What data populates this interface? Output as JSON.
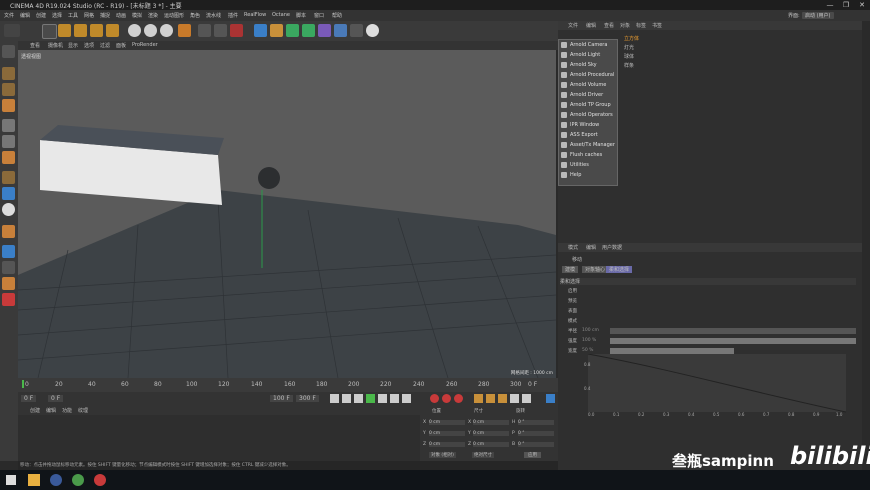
{
  "window": {
    "title": "CINEMA 4D R19.024 Studio (RC - R19) - [未标题 3 *] - 主要",
    "controls": [
      "—",
      "❐",
      "✕"
    ]
  },
  "menubar": {
    "items": [
      "文件",
      "编辑",
      "创建",
      "选择",
      "工具",
      "网格",
      "捕捉",
      "动画",
      "模拟",
      "渲染",
      "运动图形",
      "角色",
      "流水线",
      "插件",
      "RealFlow",
      "Octane",
      "脚本",
      "窗口",
      "帮助"
    ],
    "layout_label": "界面:",
    "layout_value": "启动 (用户)"
  },
  "viewport": {
    "menu": [
      "查看",
      "摄像机",
      "显示",
      "选项",
      "过滤",
      "面板",
      "ProRender"
    ],
    "camera_label": "透视视图",
    "grid_label": "网格间距 : 1000 cm"
  },
  "timeline": {
    "ticks": [
      "0",
      "20",
      "40",
      "60",
      "80",
      "100",
      "120",
      "140",
      "160",
      "180",
      "200",
      "220",
      "240",
      "260",
      "280",
      "300"
    ],
    "frame_end": "0 F"
  },
  "transport": {
    "start": "0 F",
    "current": "0 F",
    "end": "100 F",
    "max": "300 F"
  },
  "material": {
    "menu": [
      "创建",
      "编辑",
      "功能",
      "纹理"
    ]
  },
  "coords": {
    "headers": [
      "位置",
      "尺寸",
      "旋转"
    ],
    "rows": [
      {
        "axis": "X",
        "pos": "0 cm",
        "size": "0 cm",
        "rotl": "H",
        "rot": "0 °"
      },
      {
        "axis": "Y",
        "pos": "0 cm",
        "size": "0 cm",
        "rotl": "P",
        "rot": "0 °"
      },
      {
        "axis": "Z",
        "pos": "0 cm",
        "size": "0 cm",
        "rotl": "B",
        "rot": "0 °"
      }
    ],
    "mode": "对象 (相对)",
    "size_mode": "绝对尺寸",
    "apply": "应用"
  },
  "status": {
    "text": "移动：点击并拖动鼠标移动元素。按住 SHIFT 键量化移动；节点编辑模式时按住 SHIFT 键增加选择对象；按住 CTRL 键减少选择对象。"
  },
  "object_manager": {
    "menu": [
      "文件",
      "编辑",
      "查看",
      "对象",
      "标签",
      "书签"
    ],
    "objects": [
      {
        "name": "立方体"
      },
      {
        "name": "灯光"
      },
      {
        "name": "球体"
      },
      {
        "name": "样条"
      }
    ]
  },
  "dropdown_menu": {
    "items": [
      "Arnold Camera",
      "Arnold Light",
      "Arnold Sky",
      "Arnold Procedural",
      "Arnold Volume",
      "Arnold Driver",
      "Arnold TP Group",
      "Arnold Operators",
      "IPR Window",
      "ASS Export",
      "Asset/Tx Manager",
      "Flush caches",
      "Utilities",
      "Help"
    ]
  },
  "attributes": {
    "menu": [
      "模式",
      "编辑",
      "用户数据"
    ],
    "title": "移动",
    "tabs": [
      "建模",
      "对象轴心",
      "柔和选择"
    ],
    "section": "柔和选择",
    "fields": [
      "启用",
      "预览",
      "表面",
      "模式",
      "半径",
      "强度",
      "宽度"
    ],
    "field_values": [
      "",
      "",
      "",
      "",
      "100 cm",
      "100 %",
      "50 %"
    ]
  },
  "graph": {
    "x_ticks": [
      "0.0",
      "0.1",
      "0.2",
      "0.3",
      "0.4",
      "0.5",
      "0.6",
      "0.7",
      "0.8",
      "0.9",
      "1.0"
    ],
    "y_ticks": [
      "0.8",
      "0.4"
    ]
  },
  "watermark": {
    "text": "叁瓶sampinn",
    "logo": "bilibili"
  }
}
